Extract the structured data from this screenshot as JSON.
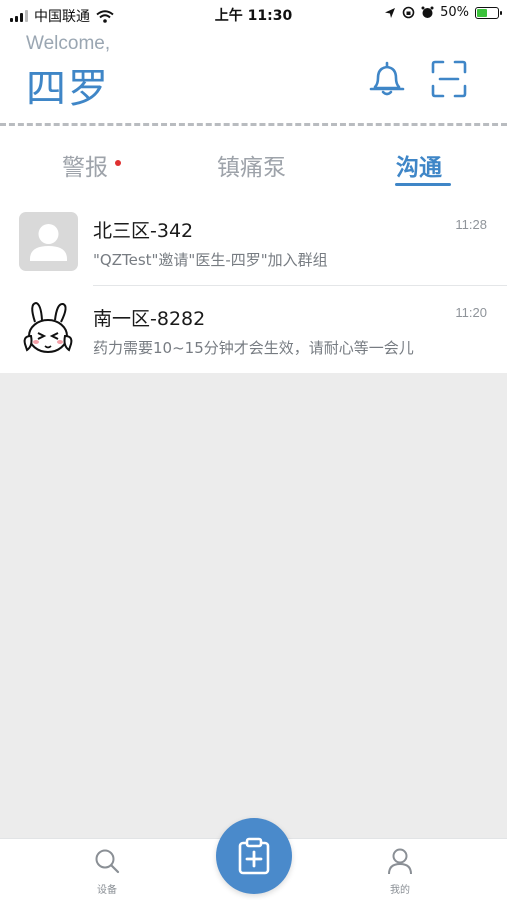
{
  "status_bar": {
    "carrier": "中国联通",
    "time": "上午 11:30",
    "battery_percent": "50%",
    "battery_level": 0.5,
    "icons": [
      "signal-icon",
      "wifi-icon",
      "location-icon",
      "orientation-lock-icon",
      "alarm-icon",
      "battery-charging-icon"
    ]
  },
  "header": {
    "welcome": "Welcome,",
    "username": "四罗",
    "icons": [
      "bell-icon",
      "scan-icon"
    ]
  },
  "tabs": [
    {
      "label": "警报",
      "has_dot": true
    },
    {
      "label": "镇痛泵",
      "has_dot": false
    },
    {
      "label": "沟通",
      "active": true
    }
  ],
  "conversations": [
    {
      "title": "北三区-342",
      "time": "11:28",
      "message": "\"QZTest\"邀请\"医生-四罗\"加入群组",
      "avatar": "default-avatar-icon"
    },
    {
      "title": "南一区-8282",
      "time": "11:20",
      "message": "药力需要10~15分钟才会生效，请耐心等一会儿",
      "avatar": "bunny-avatar"
    }
  ],
  "bottom_nav": {
    "left_label": "设备",
    "right_label": "我的",
    "icons": [
      "search-icon",
      "clipboard-plus-icon",
      "person-icon"
    ]
  },
  "colors": {
    "accent": "#3f86c7",
    "fab": "#4a8acb",
    "alert_dot": "#e03030",
    "background": "#ececec"
  }
}
